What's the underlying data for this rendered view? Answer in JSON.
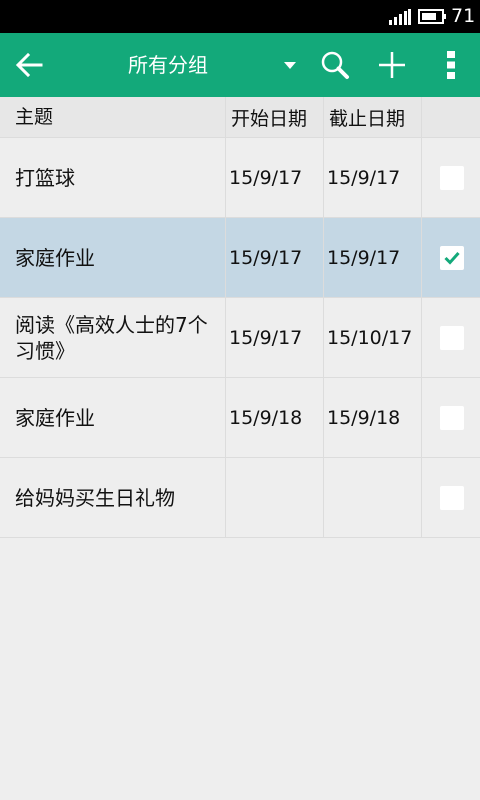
{
  "status_bar": {
    "battery": "71"
  },
  "toolbar": {
    "group_title": "所有分组"
  },
  "table": {
    "headers": {
      "subject": "主题",
      "start": "开始日期",
      "end": "截止日期"
    },
    "rows": [
      {
        "subject": "打篮球",
        "start": "15/9/17",
        "end": "15/9/17",
        "checked": false
      },
      {
        "subject": "家庭作业",
        "start": "15/9/17",
        "end": "15/9/17",
        "checked": true
      },
      {
        "subject": "阅读《高效人士的7个习惯》",
        "start": "15/9/17",
        "end": "15/10/17",
        "checked": false
      },
      {
        "subject": "家庭作业",
        "start": "15/9/18",
        "end": "15/9/18",
        "checked": false
      },
      {
        "subject": "给妈妈买生日礼物",
        "start": "",
        "end": "",
        "checked": false
      }
    ]
  },
  "colors": {
    "accent": "#13a97a",
    "selected_row": "#c4d7e4",
    "check": "#13a97a"
  }
}
